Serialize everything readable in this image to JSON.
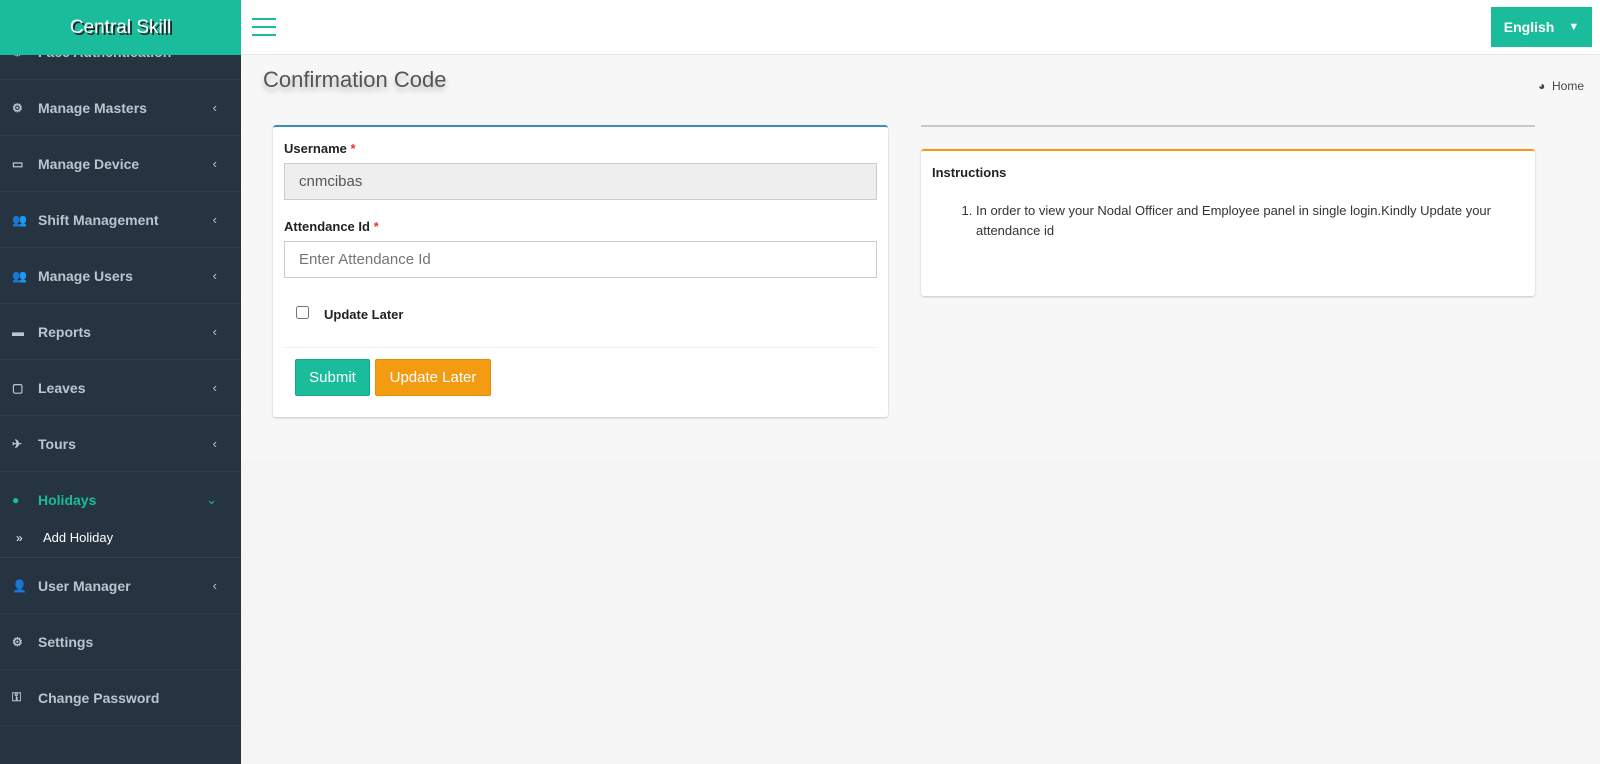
{
  "brand": "Central Skill",
  "language": "English",
  "sidebar": {
    "items": [
      {
        "label": "Face Authentication",
        "icon": "gears-icon"
      },
      {
        "label": "Manage Masters",
        "icon": "gears-icon"
      },
      {
        "label": "Manage Device",
        "icon": "laptop-icon"
      },
      {
        "label": "Shift Management",
        "icon": "users-icon"
      },
      {
        "label": "Manage Users",
        "icon": "users-icon"
      },
      {
        "label": "Reports",
        "icon": "briefcase-icon"
      },
      {
        "label": "Leaves",
        "icon": "calendar-icon"
      },
      {
        "label": "Tours",
        "icon": "plane-icon"
      },
      {
        "label": "Holidays",
        "icon": "globe-icon",
        "active": true
      },
      {
        "label": "User Manager",
        "icon": "user-icon"
      },
      {
        "label": "Settings",
        "icon": "gear-icon"
      },
      {
        "label": "Change Password",
        "icon": "key-icon"
      }
    ],
    "sub_item": "Add Holiday"
  },
  "page": {
    "title": "Confirmation Code",
    "breadcrumb": "Home"
  },
  "form": {
    "username_label": "Username",
    "username_value": "cnmcibas",
    "attendance_label": "Attendance Id",
    "attendance_placeholder": "Enter Attendance Id",
    "checkbox_label": "Update Later",
    "submit": "Submit",
    "update_later": "Update Later"
  },
  "instructions": {
    "title": "Instructions",
    "items": [
      "In order to view your Nodal Officer and Employee panel in single login.Kindly Update your attendance id"
    ]
  },
  "colors": {
    "accent": "#1abc9c",
    "warning": "#f39c12",
    "sidebar": "#263340"
  }
}
